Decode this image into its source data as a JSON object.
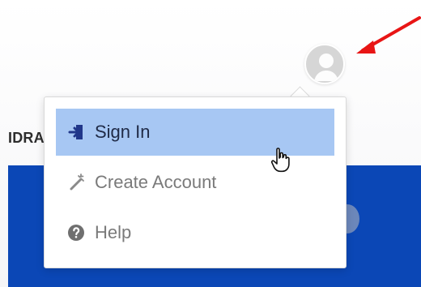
{
  "header": {
    "nav_label": "IDRA"
  },
  "user_menu": {
    "avatar_icon": "person-icon",
    "items": [
      {
        "label": "Sign In",
        "icon": "sign-in-icon",
        "state": "hovered"
      },
      {
        "label": "Create Account",
        "icon": "magic-wand-icon"
      },
      {
        "label": "Help",
        "icon": "help-icon"
      }
    ]
  },
  "colors": {
    "menu_highlight": "#A7C7F3",
    "brand_blue": "#0B47B6",
    "annotation_arrow": "#E81515"
  }
}
